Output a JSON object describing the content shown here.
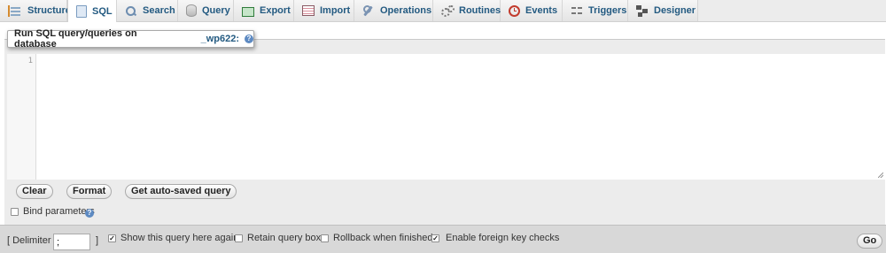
{
  "tabs": [
    {
      "label": "Structure",
      "icon": "structure-icon",
      "active": false
    },
    {
      "label": "SQL",
      "icon": "sql-icon",
      "active": true
    },
    {
      "label": "Search",
      "icon": "search-icon",
      "active": false
    },
    {
      "label": "Query",
      "icon": "query-icon",
      "active": false
    },
    {
      "label": "Export",
      "icon": "export-icon",
      "active": false
    },
    {
      "label": "Import",
      "icon": "import-icon",
      "active": false
    },
    {
      "label": "Operations",
      "icon": "operations-icon",
      "active": false
    },
    {
      "label": "Routines",
      "icon": "routines-icon",
      "active": false
    },
    {
      "label": "Events",
      "icon": "events-icon",
      "active": false
    },
    {
      "label": "Triggers",
      "icon": "triggers-icon",
      "active": false
    },
    {
      "label": "Designer",
      "icon": "designer-icon",
      "active": false
    }
  ],
  "panel": {
    "legend_text": "Run SQL query/queries on database",
    "database_name": "_wp622:",
    "help_icon": "help-icon",
    "help_glyph": "?"
  },
  "editor": {
    "line_number": "1",
    "content": ""
  },
  "buttons": {
    "clear": "Clear",
    "format": "Format",
    "auto_saved": "Get auto-saved query"
  },
  "bind_parameters": {
    "label": "Bind parameters",
    "checked": false
  },
  "footer": {
    "delimiter_open": "[ Delimiter",
    "delimiter_value": ";",
    "delimiter_close": "]",
    "show_query": {
      "label": "Show this query here again",
      "checked": true
    },
    "retain_box": {
      "label": "Retain query box",
      "checked": false
    },
    "rollback": {
      "label": "Rollback when finished",
      "checked": false
    },
    "foreign_keys": {
      "label": "Enable foreign key checks",
      "checked": true
    },
    "go": "Go"
  },
  "colors": {
    "tab_text": "#235a81",
    "panel_bg": "#ececec",
    "footer_bg": "#d8d8d8"
  }
}
